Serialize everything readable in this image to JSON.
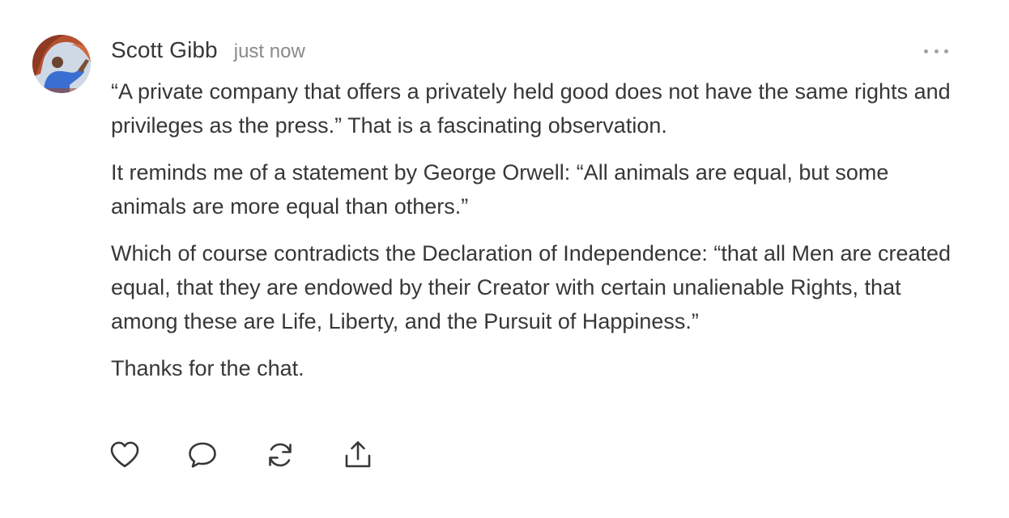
{
  "comment": {
    "author": "Scott Gibb",
    "timestamp": "just now",
    "paragraphs": [
      "“A private company that offers a privately held good does not have the same rights and privileges as the press.”  That is a fascinating observation.",
      "It reminds me of a statement by George Orwell: “All animals are equal, but some animals are more equal than others.”",
      "Which of course contradicts the Declaration of Independence: “that all Men are created equal, that they are endowed by their Creator with certain unalienable Rights, that among these are Life, Liberty, and the Pursuit of Happiness.”",
      "Thanks for the chat."
    ]
  },
  "icons": {
    "more": "more-options-icon",
    "like": "heart-icon",
    "reply": "comment-bubble-icon",
    "restack": "restack-icon",
    "share": "share-icon"
  },
  "colors": {
    "text": "#363737",
    "muted": "#8a8a8a",
    "icon": "#363737"
  }
}
